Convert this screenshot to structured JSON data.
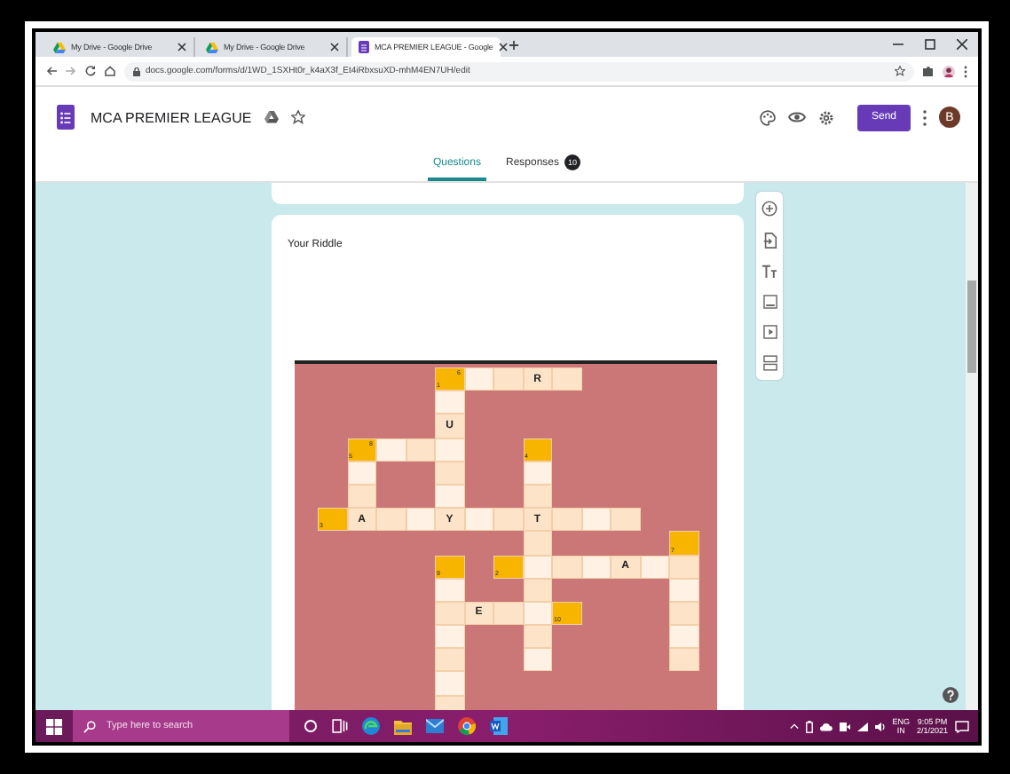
{
  "browser": {
    "tabs": [
      {
        "title": "My Drive - Google Drive",
        "selected": false
      },
      {
        "title": "My Drive - Google Drive",
        "selected": false
      },
      {
        "title": "MCA PREMIER LEAGUE - Google",
        "selected": true
      }
    ],
    "url": "docs.google.com/forms/d/1WD_1SXHt0r_k4aX3f_Et4iRbxsuXD-mhM4EN7UH/edit"
  },
  "form_header": {
    "title": "MCA PREMIER LEAGUE",
    "send_button": "Send",
    "avatar": "B"
  },
  "form_tabs": [
    {
      "label": "Questions",
      "selected": true
    },
    {
      "label": "Responses",
      "selected": false,
      "badge": "10"
    }
  ],
  "question": {
    "title": "Your Riddle",
    "crossword": {
      "rows": [
        [
          {
            "kind": "block"
          },
          {
            "kind": "block"
          },
          {
            "kind": "block"
          },
          {
            "kind": "block"
          },
          {
            "kind": "clue",
            "numbers": [
              "1",
              "6"
            ]
          },
          {
            "kind": "blank"
          },
          {
            "kind": "blank"
          },
          {
            "kind": "letter",
            "letter": "R"
          },
          {
            "kind": "blank"
          },
          {
            "kind": "block"
          },
          {
            "kind": "block"
          },
          {
            "kind": "block"
          },
          {
            "kind": "block"
          }
        ],
        [
          {
            "kind": "block"
          },
          {
            "kind": "block"
          },
          {
            "kind": "block"
          },
          {
            "kind": "block"
          },
          {
            "kind": "blank"
          },
          {
            "kind": "block"
          },
          {
            "kind": "block"
          },
          {
            "kind": "block"
          },
          {
            "kind": "block"
          },
          {
            "kind": "block"
          },
          {
            "kind": "block"
          },
          {
            "kind": "block"
          },
          {
            "kind": "block"
          }
        ],
        [
          {
            "kind": "block"
          },
          {
            "kind": "block"
          },
          {
            "kind": "block"
          },
          {
            "kind": "block"
          },
          {
            "kind": "letter",
            "letter": "U"
          },
          {
            "kind": "block"
          },
          {
            "kind": "block"
          },
          {
            "kind": "block"
          },
          {
            "kind": "block"
          },
          {
            "kind": "block"
          },
          {
            "kind": "block"
          },
          {
            "kind": "block"
          },
          {
            "kind": "block"
          }
        ],
        [
          {
            "kind": "block"
          },
          {
            "kind": "clue",
            "numbers": [
              "5",
              "8"
            ]
          },
          {
            "kind": "blank"
          },
          {
            "kind": "blank"
          },
          {
            "kind": "blank"
          },
          {
            "kind": "block"
          },
          {
            "kind": "block"
          },
          {
            "kind": "clue",
            "numbers": [
              "4"
            ]
          },
          {
            "kind": "block"
          },
          {
            "kind": "block"
          },
          {
            "kind": "block"
          },
          {
            "kind": "block"
          },
          {
            "kind": "block"
          }
        ],
        [
          {
            "kind": "block"
          },
          {
            "kind": "blank"
          },
          {
            "kind": "block"
          },
          {
            "kind": "block"
          },
          {
            "kind": "blank"
          },
          {
            "kind": "block"
          },
          {
            "kind": "block"
          },
          {
            "kind": "blank"
          },
          {
            "kind": "block"
          },
          {
            "kind": "block"
          },
          {
            "kind": "block"
          },
          {
            "kind": "block"
          },
          {
            "kind": "block"
          }
        ],
        [
          {
            "kind": "block"
          },
          {
            "kind": "blank"
          },
          {
            "kind": "block"
          },
          {
            "kind": "block"
          },
          {
            "kind": "blank"
          },
          {
            "kind": "block"
          },
          {
            "kind": "block"
          },
          {
            "kind": "blank"
          },
          {
            "kind": "block"
          },
          {
            "kind": "block"
          },
          {
            "kind": "block"
          },
          {
            "kind": "block"
          },
          {
            "kind": "block"
          }
        ],
        [
          {
            "kind": "clue",
            "numbers": [
              "3"
            ]
          },
          {
            "kind": "letter",
            "letter": "A"
          },
          {
            "kind": "blank"
          },
          {
            "kind": "blank"
          },
          {
            "kind": "letter",
            "letter": "Y"
          },
          {
            "kind": "blank"
          },
          {
            "kind": "blank"
          },
          {
            "kind": "letter",
            "letter": "T"
          },
          {
            "kind": "blank"
          },
          {
            "kind": "blank"
          },
          {
            "kind": "blank"
          },
          {
            "kind": "block"
          },
          {
            "kind": "block"
          }
        ],
        [
          {
            "kind": "block"
          },
          {
            "kind": "block"
          },
          {
            "kind": "block"
          },
          {
            "kind": "block"
          },
          {
            "kind": "block"
          },
          {
            "kind": "block"
          },
          {
            "kind": "block"
          },
          {
            "kind": "blank"
          },
          {
            "kind": "block"
          },
          {
            "kind": "block"
          },
          {
            "kind": "block"
          },
          {
            "kind": "block"
          },
          {
            "kind": "clue",
            "numbers": [
              "7"
            ]
          }
        ],
        [
          {
            "kind": "block"
          },
          {
            "kind": "block"
          },
          {
            "kind": "block"
          },
          {
            "kind": "block"
          },
          {
            "kind": "clue",
            "numbers": [
              "9"
            ]
          },
          {
            "kind": "block"
          },
          {
            "kind": "clue",
            "numbers": [
              "2"
            ]
          },
          {
            "kind": "blank"
          },
          {
            "kind": "blank"
          },
          {
            "kind": "blank"
          },
          {
            "kind": "letter",
            "letter": "A"
          },
          {
            "kind": "blank"
          },
          {
            "kind": "blank"
          }
        ],
        [
          {
            "kind": "block"
          },
          {
            "kind": "block"
          },
          {
            "kind": "block"
          },
          {
            "kind": "block"
          },
          {
            "kind": "blank"
          },
          {
            "kind": "block"
          },
          {
            "kind": "block"
          },
          {
            "kind": "blank"
          },
          {
            "kind": "block"
          },
          {
            "kind": "block"
          },
          {
            "kind": "block"
          },
          {
            "kind": "block"
          },
          {
            "kind": "blank"
          }
        ],
        [
          {
            "kind": "block"
          },
          {
            "kind": "block"
          },
          {
            "kind": "block"
          },
          {
            "kind": "block"
          },
          {
            "kind": "blank"
          },
          {
            "kind": "letter",
            "letter": "E"
          },
          {
            "kind": "blank"
          },
          {
            "kind": "blank"
          },
          {
            "kind": "clue",
            "numbers": [
              "10"
            ]
          },
          {
            "kind": "block"
          },
          {
            "kind": "block"
          },
          {
            "kind": "block"
          },
          {
            "kind": "blank"
          }
        ],
        [
          {
            "kind": "block"
          },
          {
            "kind": "block"
          },
          {
            "kind": "block"
          },
          {
            "kind": "block"
          },
          {
            "kind": "blank"
          },
          {
            "kind": "block"
          },
          {
            "kind": "block"
          },
          {
            "kind": "blank"
          },
          {
            "kind": "block"
          },
          {
            "kind": "block"
          },
          {
            "kind": "block"
          },
          {
            "kind": "block"
          },
          {
            "kind": "blank"
          }
        ],
        [
          {
            "kind": "block"
          },
          {
            "kind": "block"
          },
          {
            "kind": "block"
          },
          {
            "kind": "block"
          },
          {
            "kind": "blank"
          },
          {
            "kind": "block"
          },
          {
            "kind": "block"
          },
          {
            "kind": "blank"
          },
          {
            "kind": "block"
          },
          {
            "kind": "block"
          },
          {
            "kind": "block"
          },
          {
            "kind": "block"
          },
          {
            "kind": "blank"
          }
        ],
        [
          {
            "kind": "block"
          },
          {
            "kind": "block"
          },
          {
            "kind": "block"
          },
          {
            "kind": "block"
          },
          {
            "kind": "blank"
          },
          {
            "kind": "block"
          },
          {
            "kind": "block"
          },
          {
            "kind": "block"
          },
          {
            "kind": "block"
          },
          {
            "kind": "block"
          },
          {
            "kind": "block"
          },
          {
            "kind": "block"
          },
          {
            "kind": "block"
          }
        ],
        [
          {
            "kind": "block"
          },
          {
            "kind": "block"
          },
          {
            "kind": "block"
          },
          {
            "kind": "block"
          },
          {
            "kind": "blank"
          },
          {
            "kind": "block"
          },
          {
            "kind": "block"
          },
          {
            "kind": "block"
          },
          {
            "kind": "block"
          },
          {
            "kind": "block"
          },
          {
            "kind": "block"
          },
          {
            "kind": "block"
          },
          {
            "kind": "block"
          }
        ]
      ]
    }
  },
  "taskbar": {
    "search_placeholder": "Type here to search",
    "language": "ENG",
    "region": "IN",
    "time": "9:05 PM",
    "date": "2/1/2021"
  }
}
